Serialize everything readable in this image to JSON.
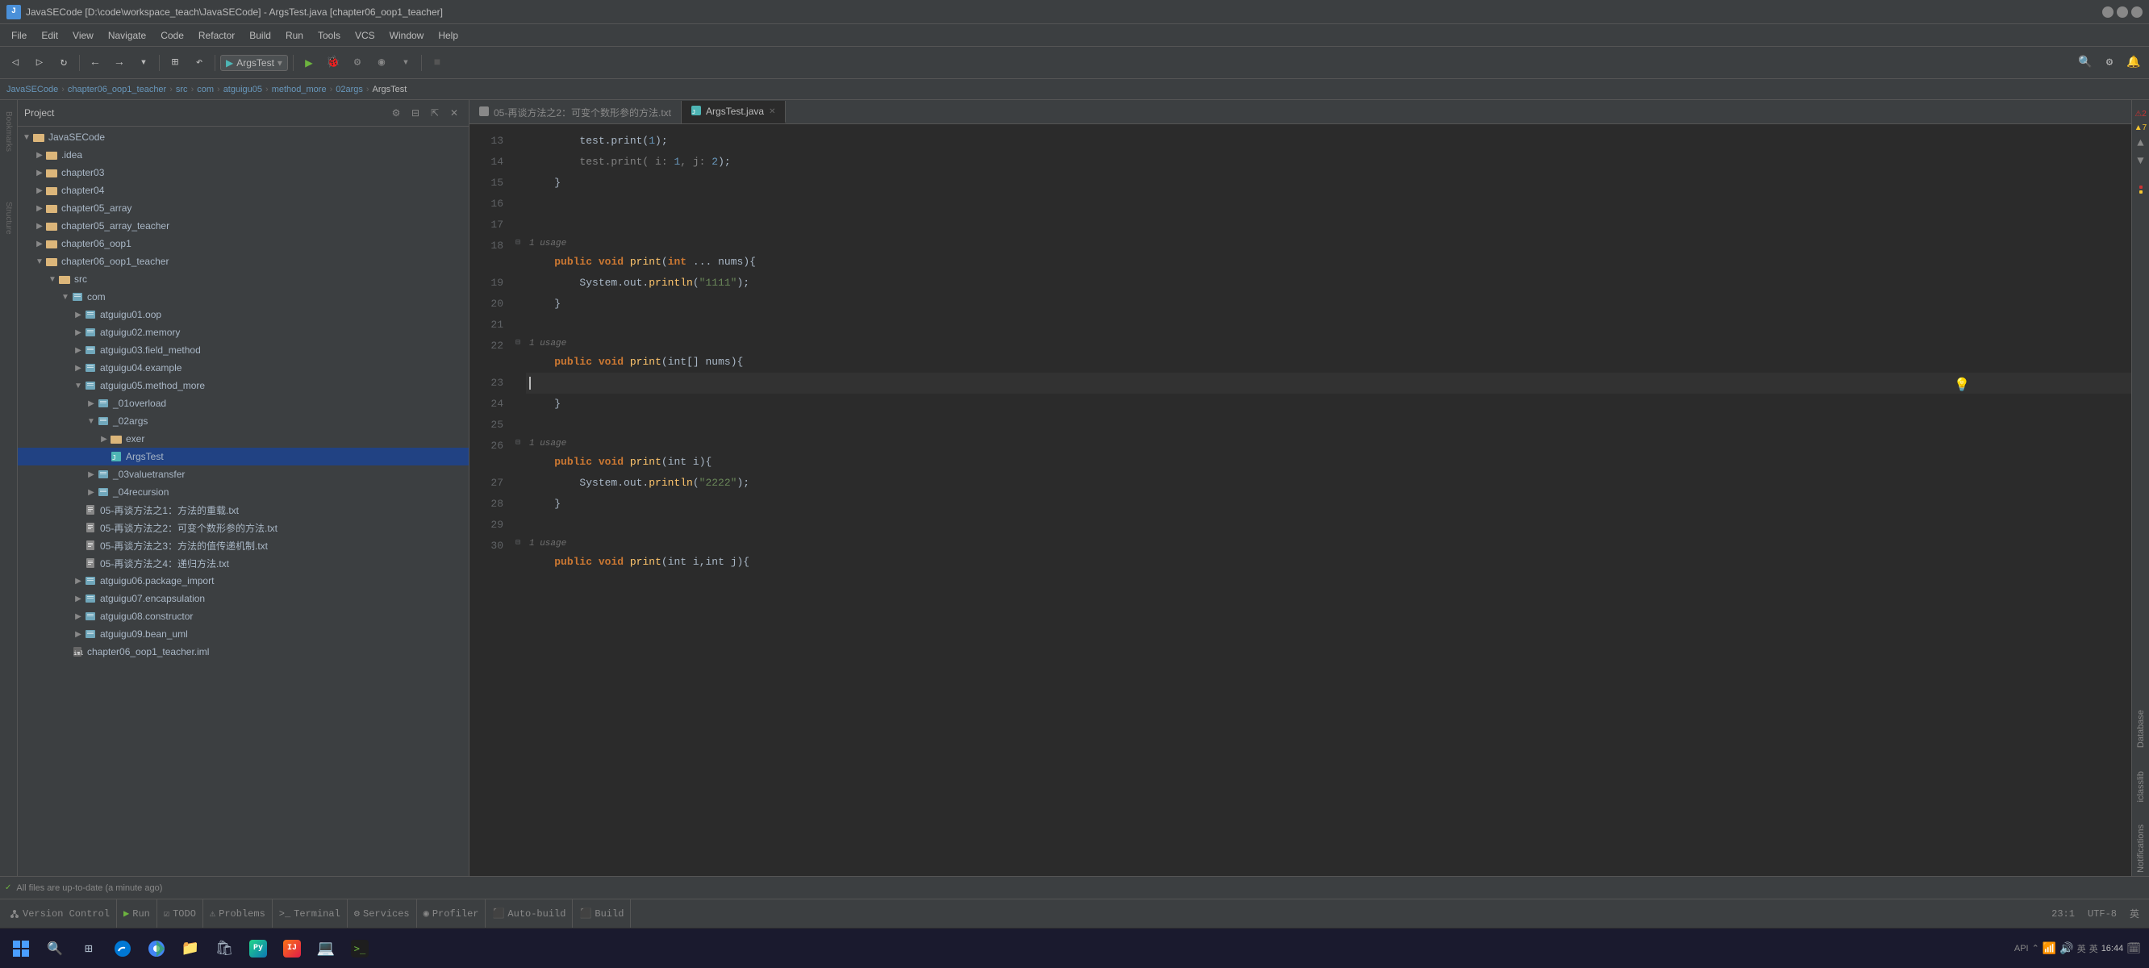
{
  "window": {
    "title": "JavaSECode [D:\\code\\workspace_teach\\JavaSECode] - ArgsTest.java [chapter06_oop1_teacher]",
    "icon": "J"
  },
  "menu": {
    "items": [
      "File",
      "Edit",
      "View",
      "Navigate",
      "Code",
      "Refactor",
      "Build",
      "Run",
      "Tools",
      "VCS",
      "Window",
      "Help"
    ]
  },
  "toolbar": {
    "run_config": "ArgsTest",
    "back_btn": "←",
    "forward_btn": "→"
  },
  "breadcrumb": {
    "items": [
      "JavaSECode",
      "chapter06_oop1_teacher",
      "src",
      "com",
      "atguigu05",
      "method_more",
      "02args",
      "ArgsTest"
    ]
  },
  "project_panel": {
    "title": "Project",
    "items": [
      {
        "label": "JavaSECode",
        "indent": 0,
        "type": "root",
        "expanded": true
      },
      {
        "label": ".idea",
        "indent": 1,
        "type": "folder"
      },
      {
        "label": "chapter03",
        "indent": 1,
        "type": "folder"
      },
      {
        "label": "chapter04",
        "indent": 1,
        "type": "folder"
      },
      {
        "label": "chapter05_array",
        "indent": 1,
        "type": "folder"
      },
      {
        "label": "chapter05_array_teacher",
        "indent": 1,
        "type": "folder"
      },
      {
        "label": "chapter06_oop1",
        "indent": 1,
        "type": "folder"
      },
      {
        "label": "chapter06_oop1_teacher",
        "indent": 1,
        "type": "folder",
        "expanded": true
      },
      {
        "label": "src",
        "indent": 2,
        "type": "folder",
        "expanded": true
      },
      {
        "label": "com",
        "indent": 3,
        "type": "package",
        "expanded": true
      },
      {
        "label": "atguigu01.oop",
        "indent": 4,
        "type": "package"
      },
      {
        "label": "atguigu02.memory",
        "indent": 4,
        "type": "package"
      },
      {
        "label": "atguigu03.field_method",
        "indent": 4,
        "type": "package"
      },
      {
        "label": "atguigu04.example",
        "indent": 4,
        "type": "package"
      },
      {
        "label": "atguigu05.method_more",
        "indent": 4,
        "type": "package",
        "expanded": true
      },
      {
        "label": "_01overload",
        "indent": 5,
        "type": "package"
      },
      {
        "label": "_02args",
        "indent": 5,
        "type": "package",
        "expanded": true
      },
      {
        "label": "exer",
        "indent": 6,
        "type": "folder"
      },
      {
        "label": "ArgsTest",
        "indent": 6,
        "type": "java_class",
        "selected": true
      },
      {
        "label": "_03valuetransfer",
        "indent": 5,
        "type": "package"
      },
      {
        "label": "_04recursion",
        "indent": 5,
        "type": "package"
      },
      {
        "label": "05-再谈方法之1：方法的重载.txt",
        "indent": 4,
        "type": "txt_file"
      },
      {
        "label": "05-再谈方法之2：可变个数形参的方法.txt",
        "indent": 4,
        "type": "txt_file"
      },
      {
        "label": "05-再谈方法之3：方法的值传递机制.txt",
        "indent": 4,
        "type": "txt_file"
      },
      {
        "label": "05-再谈方法之4：递归方法.txt",
        "indent": 4,
        "type": "txt_file"
      },
      {
        "label": "atguigu06.package_import",
        "indent": 4,
        "type": "package"
      },
      {
        "label": "atguigu07.encapsulation",
        "indent": 4,
        "type": "package"
      },
      {
        "label": "atguigu08.constructor",
        "indent": 4,
        "type": "package"
      },
      {
        "label": "atguigu09.bean_uml",
        "indent": 4,
        "type": "package"
      },
      {
        "label": "chapter06_oop1_teacher.iml",
        "indent": 3,
        "type": "iml_file"
      }
    ]
  },
  "tabs": [
    {
      "label": "05-再谈方法之2：可变个数形参的方法.txt",
      "active": false,
      "icon": "txt"
    },
    {
      "label": "ArgsTest.java",
      "active": true,
      "modified": true,
      "icon": "java"
    }
  ],
  "editor": {
    "lines": [
      {
        "num": 13,
        "content": "",
        "tokens": [
          {
            "text": "        test.print(",
            "class": ""
          },
          {
            "text": "1",
            "class": "num"
          },
          {
            "text": ");",
            "class": ""
          }
        ]
      },
      {
        "num": 14,
        "content": "",
        "tokens": [
          {
            "text": "        test.print( i: ",
            "class": "comment"
          },
          {
            "text": "1",
            "class": "num"
          },
          {
            "text": ", j: ",
            "class": "comment"
          },
          {
            "text": "2",
            "class": "num"
          },
          {
            "text": ");",
            "class": ""
          }
        ]
      },
      {
        "num": 15,
        "content": "    }",
        "tokens": [
          {
            "text": "    }",
            "class": ""
          }
        ]
      },
      {
        "num": 16,
        "content": "",
        "tokens": []
      },
      {
        "num": 17,
        "content": "",
        "tokens": []
      },
      {
        "num": 18,
        "usage": "1 usage",
        "content": "    public void print(int ... nums){",
        "tokens": [
          {
            "text": "    ",
            "class": ""
          },
          {
            "text": "public",
            "class": "kw"
          },
          {
            "text": " ",
            "class": ""
          },
          {
            "text": "void",
            "class": "kw"
          },
          {
            "text": " ",
            "class": ""
          },
          {
            "text": "print",
            "class": "method"
          },
          {
            "text": "(",
            "class": ""
          },
          {
            "text": "int",
            "class": "kw"
          },
          {
            "text": " ... nums){",
            "class": ""
          }
        ]
      },
      {
        "num": 19,
        "content": "        System.out.println(\"1111\");",
        "tokens": [
          {
            "text": "        System.out.",
            "class": ""
          },
          {
            "text": "println",
            "class": "method"
          },
          {
            "text": "(",
            "class": ""
          },
          {
            "text": "\"1111\"",
            "class": "str"
          },
          {
            "text": ");",
            "class": ""
          }
        ]
      },
      {
        "num": 20,
        "content": "    }",
        "tokens": [
          {
            "text": "    }",
            "class": ""
          }
        ]
      },
      {
        "num": 21,
        "content": "",
        "tokens": []
      },
      {
        "num": 22,
        "usage": "1 usage",
        "content": "    public void print(int[] nums){",
        "tokens": [
          {
            "text": "    ",
            "class": ""
          },
          {
            "text": "public",
            "class": "kw"
          },
          {
            "text": " ",
            "class": ""
          },
          {
            "text": "void",
            "class": "kw"
          },
          {
            "text": " ",
            "class": ""
          },
          {
            "text": "print",
            "class": "method"
          },
          {
            "text": "(int[] nums){",
            "class": ""
          }
        ]
      },
      {
        "num": 23,
        "content": "",
        "tokens": [],
        "active": true
      },
      {
        "num": 24,
        "content": "    }",
        "tokens": [
          {
            "text": "    }",
            "class": ""
          }
        ]
      },
      {
        "num": 25,
        "content": "",
        "tokens": []
      },
      {
        "num": 26,
        "usage": "1 usage",
        "content": "    public void print(int i){",
        "tokens": [
          {
            "text": "    ",
            "class": ""
          },
          {
            "text": "public",
            "class": "kw"
          },
          {
            "text": " ",
            "class": ""
          },
          {
            "text": "void",
            "class": "kw"
          },
          {
            "text": " ",
            "class": ""
          },
          {
            "text": "print",
            "class": "method"
          },
          {
            "text": "(int i){",
            "class": ""
          }
        ]
      },
      {
        "num": 27,
        "content": "        System.out.println(\"2222\");",
        "tokens": [
          {
            "text": "        System.out.",
            "class": ""
          },
          {
            "text": "println",
            "class": "method"
          },
          {
            "text": "(",
            "class": ""
          },
          {
            "text": "\"2222\"",
            "class": "str"
          },
          {
            "text": ");",
            "class": ""
          }
        ]
      },
      {
        "num": 28,
        "content": "    }",
        "tokens": [
          {
            "text": "    }",
            "class": ""
          }
        ]
      },
      {
        "num": 29,
        "content": "",
        "tokens": []
      },
      {
        "num": 30,
        "usage": "1 usage",
        "content": "    public void print(int i,int j){",
        "tokens": [
          {
            "text": "    ",
            "class": ""
          },
          {
            "text": "public",
            "class": "kw"
          },
          {
            "text": " ",
            "class": ""
          },
          {
            "text": "void",
            "class": "kw"
          },
          {
            "text": " ",
            "class": ""
          },
          {
            "text": "print",
            "class": "method"
          },
          {
            "text": "(int i,int j){",
            "class": ""
          }
        ]
      }
    ],
    "cursor_position": "23:1",
    "encoding": "UTF-8",
    "line_separator": "英"
  },
  "status_bar": {
    "items": [
      {
        "label": "Version Control",
        "icon": "vcs"
      },
      {
        "label": "Run",
        "icon": "run"
      },
      {
        "label": "TODO",
        "icon": "todo"
      },
      {
        "label": "Problems",
        "icon": "problems"
      },
      {
        "label": "Terminal",
        "icon": "terminal"
      },
      {
        "label": "Services",
        "icon": "services"
      },
      {
        "label": "Profiler",
        "icon": "profiler"
      },
      {
        "label": "Auto-build",
        "icon": "build"
      },
      {
        "label": "Build",
        "icon": "build2"
      }
    ],
    "right": {
      "cursor": "23:1",
      "encoding": "UTF-8",
      "line_sep": "英",
      "time": "16:44"
    },
    "message": "All files are up-to-date (a minute ago)"
  },
  "side_labels": [
    "Database",
    "iclasslib",
    "Notifications"
  ],
  "error_info": {
    "errors": 2,
    "warnings": 7
  },
  "taskbar": {
    "time": "16:44",
    "apps": [
      "⊞",
      "🔍",
      "📁",
      "🌐",
      "🟢",
      "🔵",
      "🟠",
      "🟣",
      "🔴",
      "⬛"
    ]
  }
}
